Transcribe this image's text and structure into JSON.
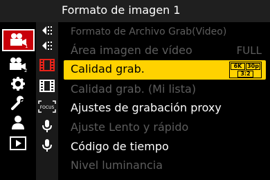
{
  "header": {
    "title": "Formato de imagen 1"
  },
  "tabs": [
    {
      "icon": "video-camera-1-icon",
      "subscript": "1",
      "active": true
    },
    {
      "icon": "video-camera-2-icon",
      "subscript": "2"
    },
    {
      "icon": "gear-icon"
    },
    {
      "icon": "wrench-icon"
    },
    {
      "icon": "person-icon"
    },
    {
      "icon": "playback-icon"
    }
  ],
  "subtabs": [
    {
      "icon": "image-format-icon"
    },
    {
      "icon": "image-format-icon"
    },
    {
      "icon": "film-frame-icon",
      "active": true
    },
    {
      "icon": "film-frame-icon"
    },
    {
      "icon": "focus-icon",
      "text": "FOCUS"
    },
    {
      "icon": "microphone-icon"
    },
    {
      "icon": "microphone-icon"
    }
  ],
  "menu": {
    "items": [
      {
        "label": "Formato de Archivo Grab(Video)",
        "state": "dim"
      },
      {
        "label": "Área imagen de vídeo",
        "value": "FULL",
        "state": "dim"
      },
      {
        "label": "Calidad grab.",
        "state": "selected",
        "badge": {
          "res": "6K",
          "fps": "30p",
          "ratio": "3:2"
        }
      },
      {
        "label": "Calidad grab. (Mi lista)",
        "state": "dim"
      },
      {
        "label": "Ajustes de grabación proxy",
        "state": "bright"
      },
      {
        "label": "Ajuste Lento y rápido",
        "state": "dim"
      },
      {
        "label": "Código de tiempo",
        "state": "bright"
      },
      {
        "label": "Nivel luminancia",
        "state": "dim"
      }
    ]
  }
}
